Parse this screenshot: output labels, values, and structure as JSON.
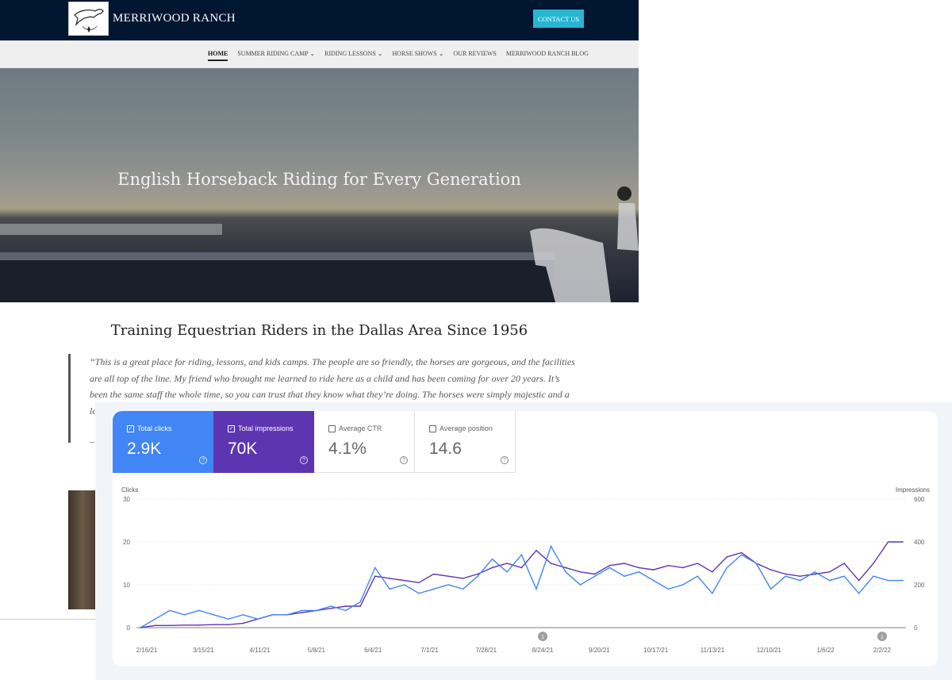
{
  "site": {
    "brand": "MERRIWOOD RANCH",
    "contact_label": "CONTACT US",
    "nav": [
      "HOME",
      "SUMMER RIDING CAMP ⌄",
      "RIDING LESSONS ⌄",
      "HORSE SHOWS ⌄",
      "OUR REVIEWS",
      "MERRIWOOD RANCH BLOG"
    ],
    "hero_title": "English Horseback Riding for Every Generation",
    "section_title": "Training Equestrian Riders in the Dallas Area Since 1956",
    "quote": "“This is a great place for riding, lessons, and kids camps. The people are so friendly, the horses are gorgeous, and the facilities are all top of the line. My friend who brought me learned to ride here as a child and has been coming for over 20 years. It’s been the same staff the whole time, so you can trust that they know what they’re doing. The horses were simply majestic and a lot of fu",
    "quote_attrib": "–",
    "colors": {
      "header": "#001631",
      "accent": "#26b6d4"
    }
  },
  "gsc": {
    "tiles": [
      {
        "label": "Total clicks",
        "value": "2.9K",
        "checked": true
      },
      {
        "label": "Total impressions",
        "value": "70K",
        "checked": true
      },
      {
        "label": "Average CTR",
        "value": "4.1%",
        "checked": false
      },
      {
        "label": "Average position",
        "value": "14.6",
        "checked": false
      }
    ],
    "colors": {
      "clicks": "#4285f4",
      "impressions": "#5e35b1"
    }
  },
  "chart_data": {
    "type": "line",
    "ylabel_left": "Clicks",
    "ylabel_right": "Impressions",
    "ylim_left": [
      0,
      30
    ],
    "ylim_right": [
      0,
      600
    ],
    "yticks_left": [
      0,
      10,
      20,
      30
    ],
    "yticks_right": [
      0,
      200,
      400,
      600
    ],
    "xticks": [
      "2/16/21",
      "3/15/21",
      "4/11/21",
      "5/8/21",
      "6/4/21",
      "7/1/21",
      "7/28/21",
      "8/24/21",
      "9/20/21",
      "10/17/21",
      "11/13/21",
      "12/10/21",
      "1/6/22",
      "2/2/22"
    ],
    "annotations": [
      {
        "x": "8/24/21",
        "label": "1"
      },
      {
        "x": "2/2/22",
        "label": "1"
      }
    ],
    "grid": true,
    "legend": "tiles-top",
    "x": [
      "2/16/21",
      "2/23/21",
      "3/2/21",
      "3/9/21",
      "3/16/21",
      "3/23/21",
      "3/30/21",
      "4/6/21",
      "4/13/21",
      "4/20/21",
      "4/27/21",
      "5/4/21",
      "5/11/21",
      "5/18/21",
      "5/25/21",
      "6/1/21",
      "6/8/21",
      "6/15/21",
      "6/22/21",
      "6/29/21",
      "7/6/21",
      "7/13/21",
      "7/20/21",
      "7/27/21",
      "8/3/21",
      "8/10/21",
      "8/17/21",
      "8/24/21",
      "8/31/21",
      "9/7/21",
      "9/14/21",
      "9/21/21",
      "9/28/21",
      "10/5/21",
      "10/12/21",
      "10/19/21",
      "10/26/21",
      "11/2/21",
      "11/9/21",
      "11/16/21",
      "11/23/21",
      "11/30/21",
      "12/7/21",
      "12/14/21",
      "12/21/21",
      "12/28/21",
      "1/4/22",
      "1/11/22",
      "1/18/22",
      "1/25/22",
      "2/1/22",
      "2/8/22",
      "2/15/22"
    ],
    "series": [
      {
        "name": "Clicks",
        "axis": "left",
        "values": [
          0,
          2,
          4,
          3,
          4,
          3,
          2,
          3,
          2,
          3,
          3,
          4,
          4,
          5,
          4,
          6,
          14,
          9,
          10,
          8,
          9,
          10,
          9,
          12,
          16,
          13,
          17,
          9,
          19,
          13,
          10,
          12,
          14,
          12,
          13,
          11,
          9,
          10,
          12,
          8,
          14,
          17,
          15,
          9,
          12,
          11,
          13,
          11,
          12,
          8,
          12,
          11,
          11
        ]
      },
      {
        "name": "Impressions",
        "axis": "right",
        "values": [
          0,
          10,
          10,
          12,
          12,
          14,
          14,
          20,
          40,
          60,
          60,
          70,
          80,
          90,
          100,
          100,
          240,
          230,
          220,
          210,
          250,
          240,
          230,
          250,
          280,
          300,
          280,
          360,
          300,
          280,
          260,
          250,
          290,
          300,
          280,
          270,
          290,
          280,
          300,
          260,
          330,
          350,
          300,
          270,
          250,
          240,
          250,
          260,
          300,
          220,
          300,
          400,
          400
        ]
      }
    ]
  }
}
